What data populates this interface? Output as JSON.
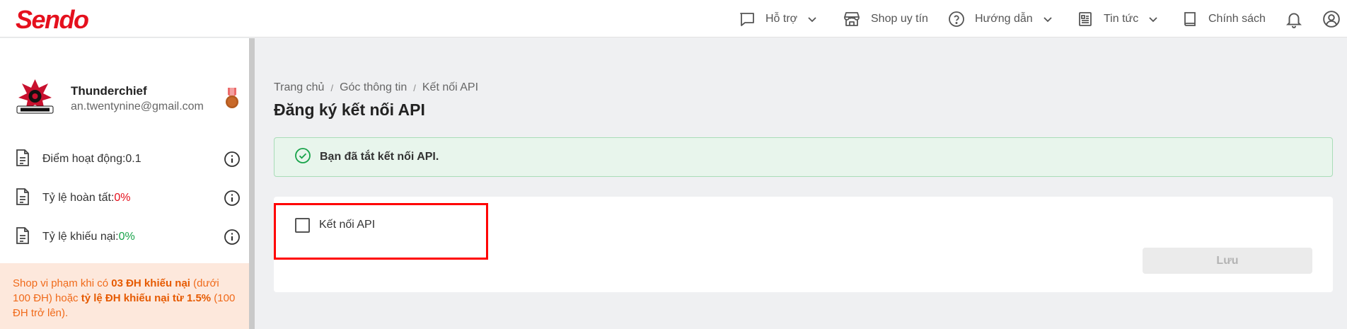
{
  "brand": {
    "logo_text": "Sendo",
    "color": "#e5101d"
  },
  "topnav": {
    "items": [
      {
        "label": "Hỗ trợ",
        "icon": "chat-icon",
        "dropdown": true
      },
      {
        "label": "Shop uy tín",
        "icon": "store-icon",
        "dropdown": false
      },
      {
        "label": "Hướng dẫn",
        "icon": "help-circle-icon",
        "dropdown": true
      },
      {
        "label": "Tin tức",
        "icon": "newspaper-icon",
        "dropdown": true
      },
      {
        "label": "Chính sách",
        "icon": "book-icon",
        "dropdown": false
      }
    ],
    "notification_icon": "bell-icon",
    "account_icon": "user-circle-icon"
  },
  "sidebar": {
    "shop_name": "Thunderchief",
    "email": "an.twentynine@gmail.com",
    "badge_icon": "medal-icon",
    "stats": [
      {
        "label": "Điểm hoạt động: ",
        "value": "0.1",
        "value_color": "#333333"
      },
      {
        "label": "Tỷ lệ hoàn tất: ",
        "value": "0%",
        "value_color": "#e5101d"
      },
      {
        "label": "Tỷ lệ khiếu nại: ",
        "value": "0%",
        "value_color": "#18a34a"
      }
    ],
    "warning": {
      "part1": "Shop vi phạm khi có ",
      "bold1": "03 ĐH khiếu nại",
      "part2": " (dưới 100 ĐH) hoặc ",
      "bold2": "tỷ lệ ĐH khiếu nại từ 1.5%",
      "part3": " (100 ĐH trở lên)."
    }
  },
  "main": {
    "breadcrumb": [
      "Trang chủ",
      "Góc thông tin",
      "Kết nối API"
    ],
    "title": "Đăng ký kết nối API",
    "alert": {
      "text": "Bạn đã tắt kết nối API.",
      "color": "#18a34a"
    },
    "checkbox": {
      "label": "Kết nối API",
      "checked": false
    },
    "save_label": "Lưu"
  },
  "highlight_color": "#ff0000"
}
